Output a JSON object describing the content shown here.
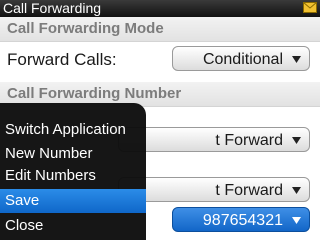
{
  "titlebar": {
    "title": "Call Forwarding",
    "icon": "envelope-icon"
  },
  "section1": {
    "header": "Call Forwarding Mode",
    "forward_calls_label": "Forward Calls:",
    "forward_calls_value": "Conditional"
  },
  "section2": {
    "header": "Call Forwarding Number",
    "row_a_value_partial": "t Forward",
    "row_b_value_partial": "t Forward",
    "number_value": "987654321"
  },
  "menu": {
    "items": [
      {
        "label": "Switch Application",
        "selected": false
      },
      {
        "label": "New Number",
        "selected": false
      },
      {
        "label": "Edit Numbers",
        "selected": false
      },
      {
        "label": "Save",
        "selected": true
      },
      {
        "label": "Close",
        "selected": false
      }
    ]
  },
  "colors": {
    "selection_blue": "#1a74d6",
    "menu_background": "#0c0c0c",
    "section_header_text": "#7c7c7c"
  }
}
